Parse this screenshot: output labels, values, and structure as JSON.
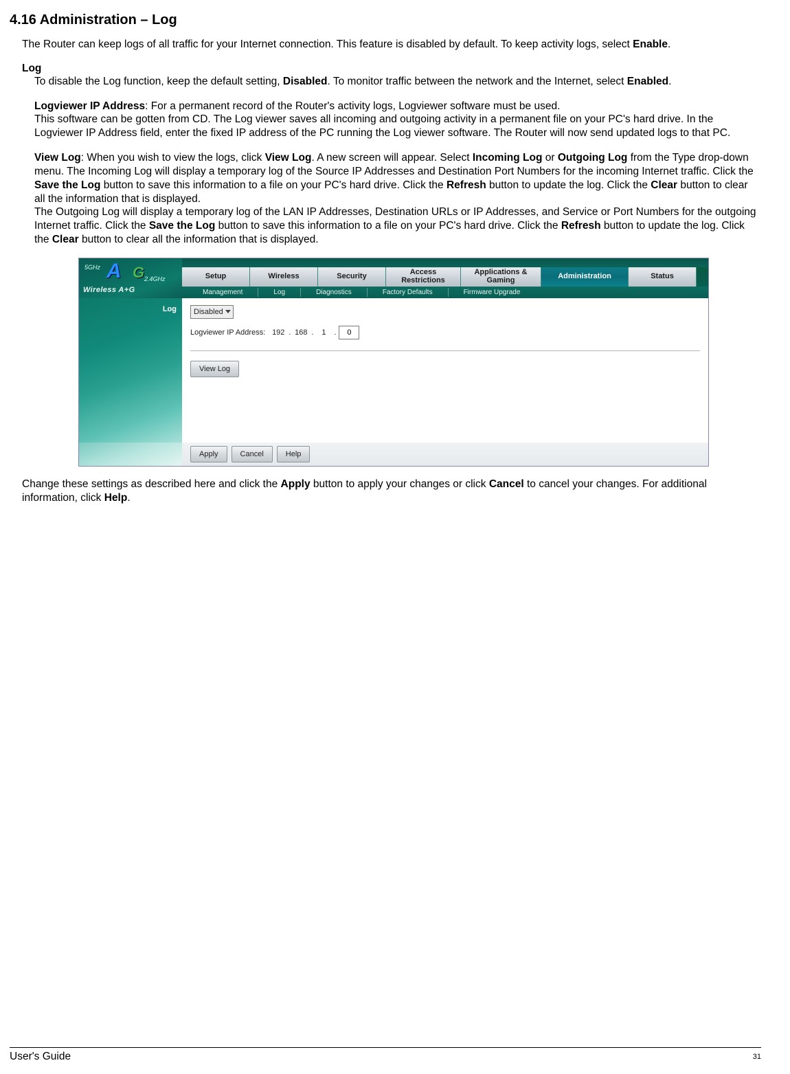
{
  "section_title": "4.16 Administration – Log",
  "p1_a": "The Router can keep logs of all traffic for your Internet connection. This feature is disabled by default. To keep activity logs, select ",
  "p1_b": "Enable",
  "p1_c": ".",
  "log_heading": "Log",
  "p2_a": "To disable the Log function, keep the default setting, ",
  "p2_b": "Disabled",
  "p2_c": ". To monitor traffic between the network and the Internet, select ",
  "p2_d": "Enabled",
  "p2_e": ".",
  "p3_a": "Logviewer IP Address",
  "p3_b": ": For a permanent record of the Router's activity logs, Logviewer software must be used.",
  "p3_c": "This software can be gotten from CD. The Log viewer saves all incoming and outgoing activity in a permanent file on your PC's hard drive. In the Logviewer IP Address field, enter the fixed IP address of the PC running the Log viewer software. The Router will now send updated logs to that PC.",
  "p4_a": "View Log",
  "p4_b": ": When you wish to view the logs, click ",
  "p4_c": "View Log",
  "p4_d": ". A new screen will appear. Select ",
  "p4_e": "Incoming Log",
  "p4_f": " or ",
  "p4_g": "Outgoing Log",
  "p4_h": " from the Type drop-down menu. The Incoming Log will display a temporary log of the Source IP Addresses and Destination Port Numbers for the incoming Internet traffic. Click the ",
  "p4_i": "Save the Log",
  "p4_j": " button to save this information to a file on your PC's hard drive. Click the ",
  "p4_k": "Refresh",
  "p4_l": " button to update the log. Click the ",
  "p4_m": "Clear",
  "p4_n": " button to clear all the information that is displayed.",
  "p4_o": "The Outgoing Log will display a temporary log of the LAN IP Addresses, Destination URLs or IP Addresses, and Service or Port Numbers for the outgoing Internet traffic. Click the ",
  "p4_p": "Save the Log",
  "p4_q": " button to save this information to a file on your PC's hard drive. Click the ",
  "p4_r": "Refresh",
  "p4_s": " button to update the log. Click the ",
  "p4_t": "Clear",
  "p4_u": " button to clear all the information that is displayed.",
  "p5_a": "Change these settings as described here and click the ",
  "p5_b": "Apply",
  "p5_c": " button to apply your changes or click ",
  "p5_d": "Cancel",
  "p5_e": " to cancel your changes. For additional information, click ",
  "p5_f": "Help",
  "p5_g": ".",
  "router": {
    "logo": {
      "five": "5GHz",
      "two": "2.4GHz",
      "big": "A",
      "g": "G",
      "wag": "Wireless A+G"
    },
    "tabs": {
      "setup": "Setup",
      "wireless": "Wireless",
      "security": "Security",
      "access": "Access Restrictions",
      "apps": "Applications & Gaming",
      "admin": "Administration",
      "status": "Status"
    },
    "subtabs": {
      "management": "Management",
      "log": "Log",
      "diagnostics": "Diagnostics",
      "factory": "Factory Defaults",
      "firmware": "Firmware Upgrade"
    },
    "side_label": "Log",
    "log_select": "Disabled",
    "ip_label": "Logviewer IP Address:",
    "ip": {
      "a": "192",
      "b": "168",
      "c": "1",
      "d": "0"
    },
    "btn_viewlog": "View Log",
    "btn_apply": "Apply",
    "btn_cancel": "Cancel",
    "btn_help": "Help"
  },
  "footer": {
    "guide": "User's Guide",
    "page": "31"
  }
}
